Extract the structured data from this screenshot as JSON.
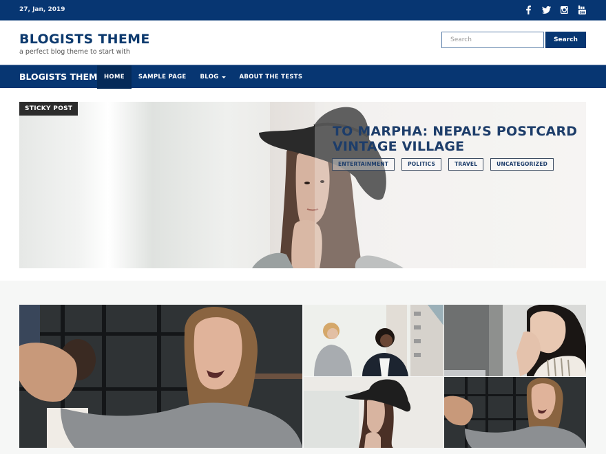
{
  "topbar": {
    "date": "27, Jan, 2019",
    "social": [
      {
        "name": "facebook-icon"
      },
      {
        "name": "twitter-icon"
      },
      {
        "name": "instagram-icon"
      },
      {
        "name": "youtube-icon"
      }
    ]
  },
  "header": {
    "site_title": "BLOGISTS THEME",
    "tagline": "a perfect blog theme to start with",
    "search_placeholder": "Search",
    "search_value": "",
    "search_button": "Search"
  },
  "nav": {
    "brand": "BLOGISTS THEME",
    "items": [
      {
        "label": "HOME",
        "active": true
      },
      {
        "label": "SAMPLE PAGE",
        "active": false
      },
      {
        "label": "BLOG",
        "active": false,
        "has_dropdown": true
      },
      {
        "label": "ABOUT THE TESTS",
        "active": false
      }
    ]
  },
  "hero": {
    "badge": "STICKY POST",
    "title": "TO MARPHA: NEPAL’S POSTCARD VINTAGE VILLAGE",
    "categories": [
      "ENTERTAINMENT",
      "POLITICS",
      "TRAVEL",
      "UNCATEGORIZED"
    ]
  },
  "gallery": {
    "images": [
      {
        "name": "woman-handshake-smiling"
      },
      {
        "name": "two-women-walking"
      },
      {
        "name": "woman-thinking-at-desk"
      },
      {
        "name": "woman-in-black-hat"
      },
      {
        "name": "woman-handshake-smiling-small"
      }
    ]
  },
  "colors": {
    "brand": "#073672",
    "title": "#0d3a6e",
    "badge": "#2c2c2c"
  }
}
